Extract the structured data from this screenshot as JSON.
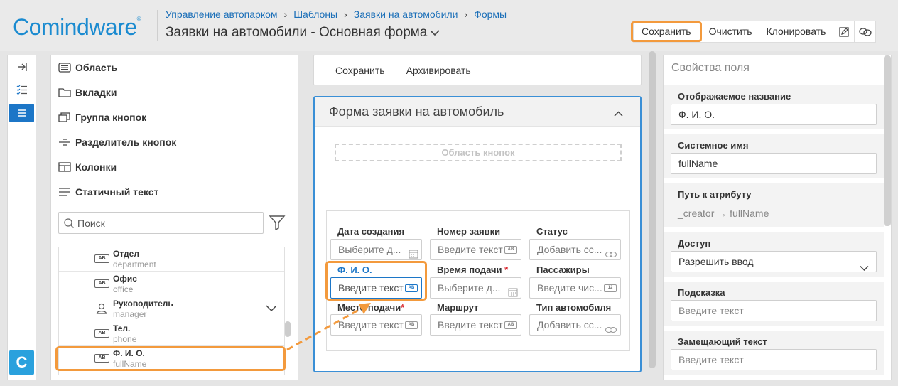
{
  "app": {
    "logo": "Comindware",
    "logo_mark": "®"
  },
  "breadcrumb": [
    "Управление автопарком",
    "Шаблоны",
    "Заявки на автомобили",
    "Формы"
  ],
  "page_title": "Заявки на автомобили - Основная форма",
  "toolbar": {
    "save_label": "Сохранить",
    "clear_label": "Очистить",
    "clone_label": "Клонировать"
  },
  "rail": {
    "logo_letter": "C"
  },
  "components": {
    "items": [
      "Область",
      "Вкладки",
      "Группа кнопок",
      "Разделитель кнопок",
      "Колонки",
      "Статичный текст"
    ],
    "search_placeholder": "Поиск",
    "attributes": [
      {
        "name": "Отдел",
        "system": "department",
        "type": "AB"
      },
      {
        "name": "Офис",
        "system": "office",
        "type": "AB"
      },
      {
        "name": "Руководитель",
        "system": "manager",
        "type": "user"
      },
      {
        "name": "Тел.",
        "system": "phone",
        "type": "AB"
      },
      {
        "name": "Ф. И. О.",
        "system": "fullName",
        "type": "AB"
      }
    ]
  },
  "form_toolbar": {
    "save_label": "Сохранить",
    "archive_label": "Архивировать"
  },
  "form": {
    "title": "Форма заявки на автомобиль",
    "button_area_label": "Область кнопок",
    "fields": [
      {
        "label": "Дата создания",
        "required": false,
        "placeholder": "Выберите д...",
        "icon": "calendar-icon"
      },
      {
        "label": "Номер заявки",
        "required": false,
        "placeholder": "Введите текст",
        "icon": "ab-icon"
      },
      {
        "label": "Статус",
        "required": false,
        "placeholder": "Добавить сс...",
        "icon": "link-icon"
      },
      {
        "label": "Ф. И. О.",
        "required": false,
        "placeholder": "Введите текст",
        "icon": "ab-icon",
        "selected": true
      },
      {
        "label": "Время подачи",
        "required": true,
        "placeholder": "Выберите д...",
        "icon": "calendar-icon"
      },
      {
        "label": "Пассажиры",
        "required": false,
        "placeholder": "Введите чис...",
        "icon": "number-icon"
      },
      {
        "label": "Место подачи",
        "required": true,
        "placeholder": "Введите текст",
        "icon": "ab-icon"
      },
      {
        "label": "Маршрут",
        "required": false,
        "placeholder": "Введите текст",
        "icon": "ab-icon"
      },
      {
        "label": "Тип автомобиля",
        "required": false,
        "placeholder": "Добавить сс...",
        "icon": "link-icon"
      }
    ],
    "required_mark": "*"
  },
  "properties": {
    "title": "Свойства поля",
    "display_name_label": "Отображаемое название",
    "display_name_value": "Ф. И. О.",
    "system_name_label": "Системное имя",
    "system_name_value": "fullName",
    "path_label": "Путь к атрибуту",
    "path_value": "_creator → fullName",
    "access_label": "Доступ",
    "access_value": "Разрешить ввод",
    "hint_label": "Подсказка",
    "hint_placeholder": "Введите текст",
    "placeholder_label": "Замещающий текст",
    "placeholder_placeholder": "Введите текст"
  },
  "colors": {
    "accent": "#1c76c7",
    "highlight": "#f39a3d",
    "required": "#d9242b"
  }
}
